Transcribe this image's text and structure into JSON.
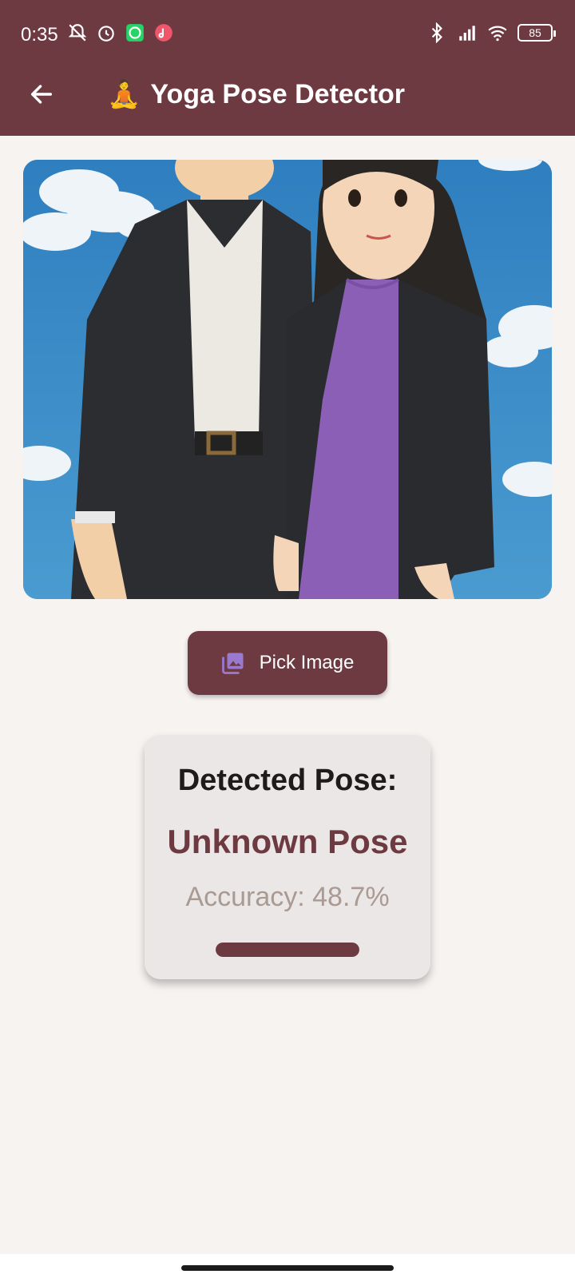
{
  "status_bar": {
    "time": "0:35",
    "battery": "85"
  },
  "app_bar": {
    "title_emoji": "🧘",
    "title": "Yoga Pose Detector",
    "back_icon": "arrow-back-icon"
  },
  "image_preview": {
    "description_icon": "photo"
  },
  "pick_button": {
    "label": "Pick Image",
    "icon": "photo-library-icon"
  },
  "result": {
    "heading": "Detected Pose:",
    "pose": "Unknown Pose",
    "accuracy_text": "Accuracy: 48.7%",
    "progress": 1.0
  },
  "colors": {
    "primary": "#6e3a41",
    "background": "#f7f3f1",
    "card": "#ebe7e6",
    "accuracy_text": "#a99a93"
  }
}
